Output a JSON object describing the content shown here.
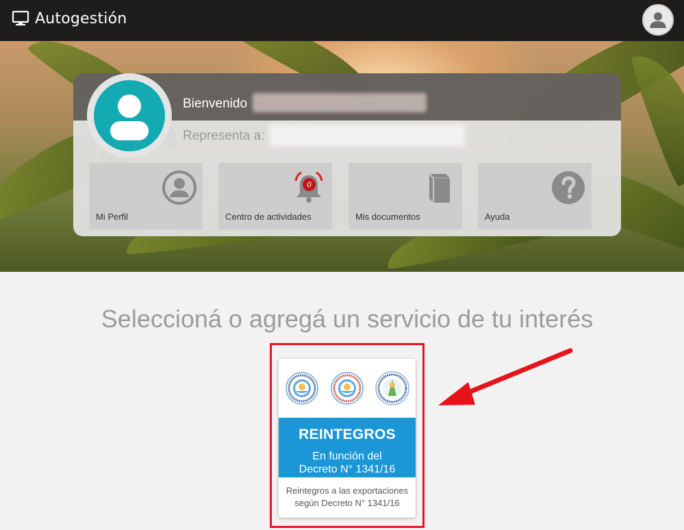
{
  "header": {
    "app_title": "Autogestión",
    "brand_icon": "monitor-icon",
    "user_icon": "user-icon"
  },
  "welcome_card": {
    "greeting_label": "Bienvenido",
    "represents_label": "Representa a:",
    "tiles": [
      {
        "label": "Mi Perfil",
        "icon": "user-circle-icon"
      },
      {
        "label": "Centro de actividades",
        "icon": "bell-icon",
        "badge": "0"
      },
      {
        "label": "Mis documentos",
        "icon": "book-icon"
      },
      {
        "label": "Ayuda",
        "icon": "question-icon"
      }
    ]
  },
  "services": {
    "title": "Seleccioná o agregá un servicio de tu interés",
    "card": {
      "banner_title": "REINTEGROS",
      "banner_line1": "En función del",
      "banner_line2": "Decreto N° 1341/16",
      "description_line1": "Reintegros a las exportaciones",
      "description_line2": "según Decreto N° 1341/16"
    }
  },
  "colors": {
    "topbar": "#1f1d1c",
    "avatar": "#13aab1",
    "banner": "#1b96d7",
    "highlight": "#e5141b",
    "badge": "#c4161c"
  }
}
